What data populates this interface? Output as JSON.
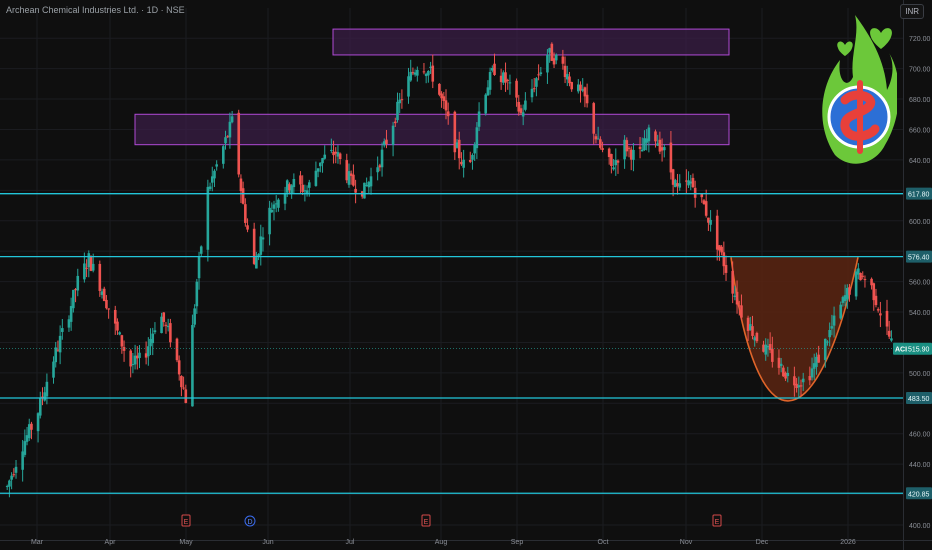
{
  "header": {
    "symbol_title": "Archean Chemical Industries Ltd. · 1D · NSE",
    "currency": "INR"
  },
  "colors": {
    "background": "#0f0f0f",
    "up": "#26a69a",
    "down": "#ef5350",
    "level_line": "#22c6da",
    "zone_border": "#b04ad6",
    "zone_fill": "#3a1d46",
    "cup_fill": "#5a2412",
    "cup_stroke": "#e0652a"
  },
  "chart_data": {
    "type": "candlestick",
    "symbol": "ACI",
    "interval": "1D",
    "ylim": [
      400,
      730
    ],
    "y_ticks": [
      400,
      420,
      440,
      460,
      480,
      500,
      520,
      540,
      560,
      580,
      600,
      620,
      640,
      660,
      680,
      700,
      720
    ],
    "x_ticks": [
      "Mar",
      "Apr",
      "May",
      "Jun",
      "Jul",
      "Aug",
      "Sep",
      "Oct",
      "Nov",
      "Dec",
      "2026"
    ],
    "horizontal_levels": [
      {
        "value": 617.8,
        "label": "617.80"
      },
      {
        "value": 576.4,
        "label": "576.40"
      },
      {
        "value": 483.5,
        "label": "483.50"
      },
      {
        "value": 420.85,
        "label": "420.85"
      }
    ],
    "last_price": {
      "symbol": "ACI",
      "value": 515.9,
      "label": "515.90"
    },
    "resistance_zones": [
      {
        "from": 709,
        "to": 726,
        "start": "Jul",
        "end": "Nov"
      },
      {
        "from": 650,
        "to": 670,
        "start": "Apr",
        "end": "Nov"
      }
    ],
    "cup_pattern": {
      "left_rim": 576,
      "bottom": 483,
      "right_rim": 576,
      "start": "Nov",
      "end": "2026"
    },
    "event_markers": [
      {
        "type": "earnings",
        "label": "E",
        "near": "May"
      },
      {
        "type": "dividend",
        "label": "D",
        "near": "May"
      },
      {
        "type": "earnings",
        "label": "E",
        "near": "Aug"
      },
      {
        "type": "earnings",
        "label": "E",
        "near": "Nov"
      }
    ],
    "price_path": [
      [
        1,
        425
      ],
      [
        7,
        450
      ],
      [
        14,
        470
      ],
      [
        21,
        505
      ],
      [
        27,
        530
      ],
      [
        33,
        560
      ],
      [
        38,
        575
      ],
      [
        44,
        555
      ],
      [
        50,
        530
      ],
      [
        57,
        505
      ],
      [
        63,
        510
      ],
      [
        70,
        540
      ],
      [
        76,
        520
      ],
      [
        82,
        483
      ],
      [
        87,
        560
      ],
      [
        92,
        620
      ],
      [
        97,
        640
      ],
      [
        103,
        665
      ],
      [
        108,
        610
      ],
      [
        113,
        570
      ],
      [
        118,
        600
      ],
      [
        123,
        615
      ],
      [
        130,
        625
      ],
      [
        137,
        620
      ],
      [
        143,
        640
      ],
      [
        150,
        645
      ],
      [
        157,
        625
      ],
      [
        163,
        620
      ],
      [
        170,
        640
      ],
      [
        176,
        665
      ],
      [
        182,
        690
      ],
      [
        188,
        705
      ],
      [
        194,
        695
      ],
      [
        199,
        675
      ],
      [
        204,
        650
      ],
      [
        210,
        630
      ],
      [
        216,
        680
      ],
      [
        222,
        700
      ],
      [
        228,
        690
      ],
      [
        234,
        670
      ],
      [
        240,
        690
      ],
      [
        246,
        710
      ],
      [
        252,
        705
      ],
      [
        257,
        690
      ],
      [
        263,
        680
      ],
      [
        269,
        650
      ],
      [
        275,
        635
      ],
      [
        281,
        650
      ],
      [
        287,
        640
      ],
      [
        293,
        660
      ],
      [
        299,
        645
      ],
      [
        305,
        620
      ],
      [
        311,
        625
      ],
      [
        317,
        610
      ],
      [
        323,
        585
      ],
      [
        329,
        560
      ],
      [
        334,
        540
      ],
      [
        340,
        525
      ],
      [
        345,
        515
      ],
      [
        351,
        505
      ],
      [
        357,
        495
      ],
      [
        363,
        495
      ],
      [
        369,
        510
      ],
      [
        375,
        530
      ],
      [
        381,
        550
      ],
      [
        387,
        565
      ],
      [
        392,
        560
      ],
      [
        397,
        540
      ],
      [
        402,
        520
      ]
    ]
  }
}
